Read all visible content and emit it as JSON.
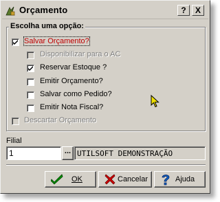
{
  "window": {
    "title": "Orçamento"
  },
  "titlebar": {
    "help_label": "?",
    "close_label": "X"
  },
  "group": {
    "label": "Escolha uma opção:",
    "options": [
      {
        "label": "Salvar Orçamento?",
        "checked": true,
        "enabled": true
      },
      {
        "label": "Disponibilizar para o AC",
        "checked": false,
        "enabled": false
      },
      {
        "label": "Reservar Estoque ?",
        "checked": true,
        "enabled": true
      },
      {
        "label": "Emitir Orçamento?",
        "checked": false,
        "enabled": true
      },
      {
        "label": "Salvar como Pedido?",
        "checked": false,
        "enabled": true
      },
      {
        "label": "Emitir Nota Fiscal?",
        "checked": false,
        "enabled": true
      },
      {
        "label": "Descartar Orçamento",
        "checked": false,
        "enabled": false
      }
    ]
  },
  "filial": {
    "label": "Filial",
    "code": "1",
    "lookup_label": "...",
    "name": "UTILSOFT DEMONSTRAÇÃO"
  },
  "buttons": {
    "ok": "OK",
    "cancel": "Cancelar",
    "help": "Ajuda"
  },
  "colors": {
    "highlight": "#c00000",
    "dialog": "#d4d0c8",
    "check": "#008000"
  }
}
